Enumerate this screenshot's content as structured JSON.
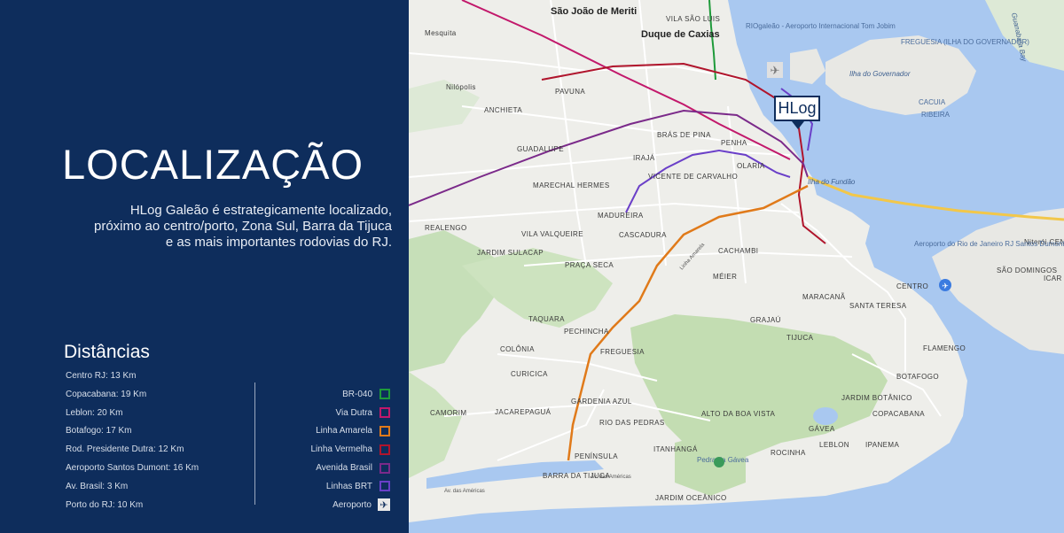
{
  "title": "LOCALIZAÇÃO",
  "intro": "HLog Galeão é estrategicamente localizado, próximo ao centro/porto, Zona Sul, Barra da Tijuca e as mais importantes rodovias do RJ.",
  "distances": {
    "title": "Distâncias",
    "items": [
      "Centro RJ: 13 Km",
      "Copacabana: 19 Km",
      "Leblon: 20 Km",
      "Botafogo: 17 Km",
      "Rod. Presidente Dutra: 12 Km",
      "Aeroporto Santos Dumont: 16 Km",
      "Av. Brasil: 3 Km",
      "Porto do RJ: 10 Km"
    ]
  },
  "legend": [
    {
      "label": "BR-040",
      "color": "#1e9a3a",
      "icon": "square"
    },
    {
      "label": "Via Dutra",
      "color": "#c2186b",
      "icon": "square"
    },
    {
      "label": "Linha Amarela",
      "color": "#e07a1a",
      "icon": "square"
    },
    {
      "label": "Linha Vermelha",
      "color": "#b0142c",
      "icon": "square"
    },
    {
      "label": "Avenida Brasil",
      "color": "#7b2a8a",
      "icon": "square"
    },
    {
      "label": "Linhas BRT",
      "color": "#6a3fc8",
      "icon": "square"
    },
    {
      "label": "Aeroporto",
      "color": "#e8e8e8",
      "icon": "airplane-icon"
    }
  ],
  "marker": {
    "label": "HLog"
  },
  "map": {
    "places_big": [
      "São João de Meriti",
      "Duque de Caxias"
    ],
    "places": [
      "Mesquita",
      "VILA SÃO LUIS",
      "Nilópolis",
      "PAVUNA",
      "ANCHIETA",
      "BRÁS DE PINA",
      "PENHA",
      "GUADALUPE",
      "IRAJÁ",
      "OLARIA",
      "MARECHAL HERMES",
      "VICENTE DE CARVALHO",
      "REALENGO",
      "MADUREIRA",
      "VILA VALQUEIRE",
      "CASCADURA",
      "JARDIM SULACAP",
      "PRAÇA SECA",
      "CACHAMBI",
      "MÉIER",
      "MARACANÃ",
      "CENTRO",
      "SANTA TERESA",
      "TAQUARA",
      "GRAJAÚ",
      "PECHINCHA",
      "TIJUCA",
      "FREGUESIA",
      "COLÔNIA",
      "FLAMENGO",
      "CURICICA",
      "BOTAFOGO",
      "JARDIM BOTÂNICO",
      "GARDENIA AZUL",
      "COPACABANA",
      "JACAREPAGUÁ",
      "CAMORIM",
      "ALTO DA BOA VISTA",
      "GÁVEA",
      "RIO DAS PEDRAS",
      "LEBLON",
      "IPANEMA",
      "ITANHANGÁ",
      "ROCINHA",
      "PENÍNSULA",
      "BARRA DA TIJUCA",
      "JARDIM OCEÂNICO",
      "FREGUESIA (ILHA DO GOVERNADOR)",
      "CACUIA",
      "RIBEIRA",
      "Ilha do Governador",
      "Ilha do Fundão",
      "Niterói CENTRO",
      "SÃO DOMINGOS",
      "ICAR"
    ],
    "pois": [
      "RIOgaleão - Aeroporto Internacional Tom Jobim",
      "Aeroporto do Rio de Janeiro RJ Santos Dumont",
      "Pedra da Gávea",
      "Guanabara Bay"
    ],
    "roads": [
      "Av. das Américas",
      "Av. das Américas",
      "Linha Amarela"
    ]
  }
}
